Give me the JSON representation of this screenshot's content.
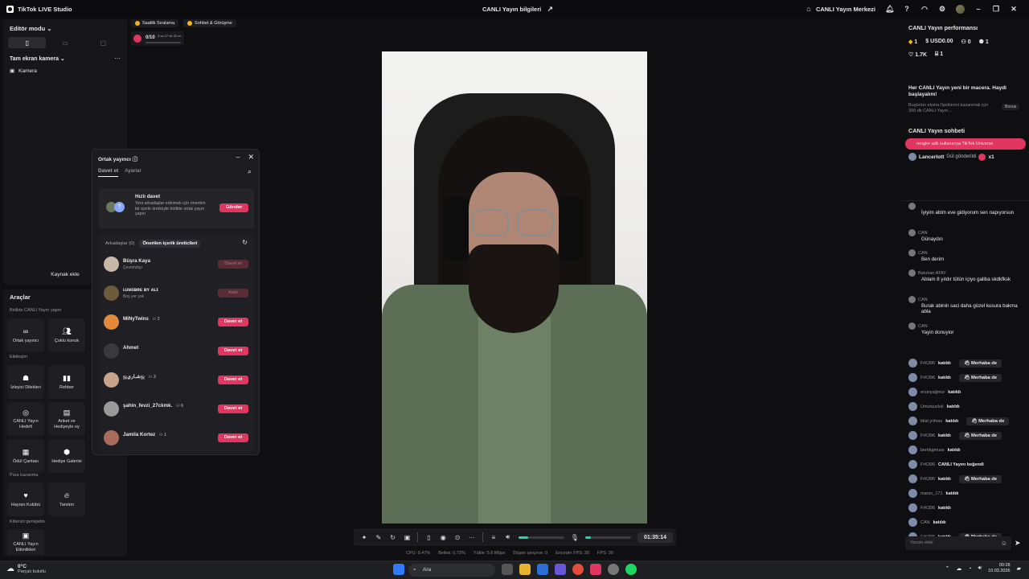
{
  "titlebar": {
    "app": "TikTok LIVE Studio",
    "center": "CANLI Yayın bilgileri",
    "center_link": "CANLI Yayın Merkezi"
  },
  "left": {
    "editor_mode": "Editör modu",
    "scene": "Tam ekran kamera",
    "source": "Kamera",
    "add_source": "Kaynak ekle"
  },
  "tools": {
    "title": "Araçlar",
    "sec1": "Birlikte CANLI Yayın yapın",
    "co_host": "Ortak yayıncı",
    "multi_guest": "Çoklu konuk",
    "sec2": "Etkileşim",
    "viewer_wishes": "İzleyici Dilekleri",
    "guide": "Rehber",
    "live_goal": "CANLI Yayın Hedefi",
    "poll": "Anket ve Hediyeyle oy",
    "treasure": "Ödül Çantası",
    "gift_gallery": "Hediye Galerisi",
    "sec3": "Para kazanma",
    "fan_club": "Hayran Kulübü",
    "promote": "Tanıtım",
    "sec4": "Kitlenizi genişletin",
    "live_events": "CANLI Yayın Etkinlikleri"
  },
  "badges": {
    "rank": "Saatlik Sıralama",
    "chat": "Sohbet & Görüşme",
    "goal": "0/10",
    "goal_time": "3 sa 47 dk 35 sn"
  },
  "invite": {
    "title": "Ortak yayıncı",
    "tab1": "Davet et",
    "tab2": "Ayarlar",
    "quick_title": "Hızlı davet",
    "quick_desc": "Yeni arkadaşlar edinmek için önerilen bir içerik üreticiyle birlikte ortak yayın yapın",
    "send": "Gönder",
    "friends": "Arkadaşlar (0)",
    "recommended": "Önerilen içerik üreticileri",
    "rows": [
      {
        "name": "Büşra Kaya",
        "sub": "Çevrimdışı",
        "count": "",
        "action": "Davet et",
        "state": "disabled"
      },
      {
        "name": "ʟᴜᴍɪʙʀᴇ ʙʏ ᴀʟɪ",
        "sub": "Boş yer yok",
        "count": "",
        "action": "Katıl",
        "state": "disabled"
      },
      {
        "name": "MiNyTwins",
        "sub": "",
        "count": "2",
        "action": "Davet et",
        "state": "active"
      },
      {
        "name": "Ahmet",
        "sub": "",
        "count": "",
        "action": "Davet et",
        "state": "active"
      },
      {
        "name": "ஜشـاريஜ",
        "sub": "",
        "count": "3",
        "action": "Davet et",
        "state": "active"
      },
      {
        "name": "şahin_fevzi_27ckmk.",
        "sub": "",
        "count": "6",
        "action": "Davet et",
        "state": "active"
      },
      {
        "name": "Jamila Kortez",
        "sub": "",
        "count": "1",
        "action": "Davet et",
        "state": "active"
      }
    ]
  },
  "controls": {
    "timer": "01:35:14",
    "mic_level": 0.22,
    "volume_level": 0.12
  },
  "stats": [
    "CPU: 0.47%",
    "Bellek: 0.72%",
    "Yükle: 5.8 Mbps",
    "Düşen çerçeve: 0",
    "Encoder FPS: 30",
    "FPS: 30"
  ],
  "right": {
    "perf_title": "CANLI Yayın performansı",
    "diamonds": "1",
    "usd": "USD0.00",
    "viewers": "0",
    "new_followers": "1",
    "likes": "1.7K",
    "gifts": "1",
    "promo": "Her CANLI Yayın yeni bir macera. Haydi başlayalım!",
    "promo_sub": "Bugünün ekstra fişeklerini kazanmak için 300 dk CANLI Yayın...",
    "bonus": "Bonus",
    "chat_title": "CANLI Yayın sohbeti",
    "pinned": "rengin• adlı kullanıcıya TikTok Universe",
    "gift_user": "Lancerlott",
    "gift_text": "Gül gönderildi",
    "gift_count": "x1",
    "messages": [
      {
        "user": "",
        "text": "İyiyim abim eve gidiyorum sen napıyorsun"
      },
      {
        "user": "CAN",
        "text": "Günaydın"
      },
      {
        "user": "CAN",
        "text": "Ben derim"
      },
      {
        "user": "Batuhan ATAY",
        "text": "Ablam 8 yıldır tütün içiyo galiba skdkfksk"
      },
      {
        "user": "CAN",
        "text": "Burak abinin saci daha güzel kusura bakma abla"
      },
      {
        "user": "CAN",
        "text": "Yayin donuyior"
      }
    ],
    "joins": [
      {
        "user": "FrK396",
        "text": "katıldı",
        "hello": "Merhaba de"
      },
      {
        "user": "FrK396",
        "text": "katıldı",
        "hello": "Merhaba de"
      },
      {
        "user": "ersinyağmur",
        "text": "katıldı",
        "hello": ""
      },
      {
        "user": "Umutsuzluk",
        "text": "katıldı",
        "hello": ""
      },
      {
        "user": "bilal yılmaz",
        "text": "katıldı",
        "hello": "Merhaba de"
      },
      {
        "user": "FrK396",
        "text": "katıldı",
        "hello": "Merhaba de"
      },
      {
        "user": "berkkgmuss",
        "text": "katıldı",
        "hello": ""
      },
      {
        "user": "FrK396",
        "text": "CANLI Yayını beğendi",
        "hello": ""
      },
      {
        "user": "FrK396",
        "text": "katıldı",
        "hello": "Merhaba de"
      },
      {
        "user": "marso_171",
        "text": "katıldı",
        "hello": ""
      },
      {
        "user": "FrK396",
        "text": "katıldı",
        "hello": ""
      },
      {
        "user": "CAN",
        "text": "katıldı",
        "hello": ""
      },
      {
        "user": "FrK396",
        "text": "katıldı",
        "hello": "Merhaba de"
      }
    ],
    "comment_placeholder": "Yorum ekle"
  },
  "taskbar": {
    "temp": "0°C",
    "weather": "Parçalı bulutlu",
    "search": "Ara",
    "time": "00:28",
    "date": "10.03.2026"
  },
  "colors": {
    "accent": "#e1365f",
    "teal": "#21d6b4"
  }
}
